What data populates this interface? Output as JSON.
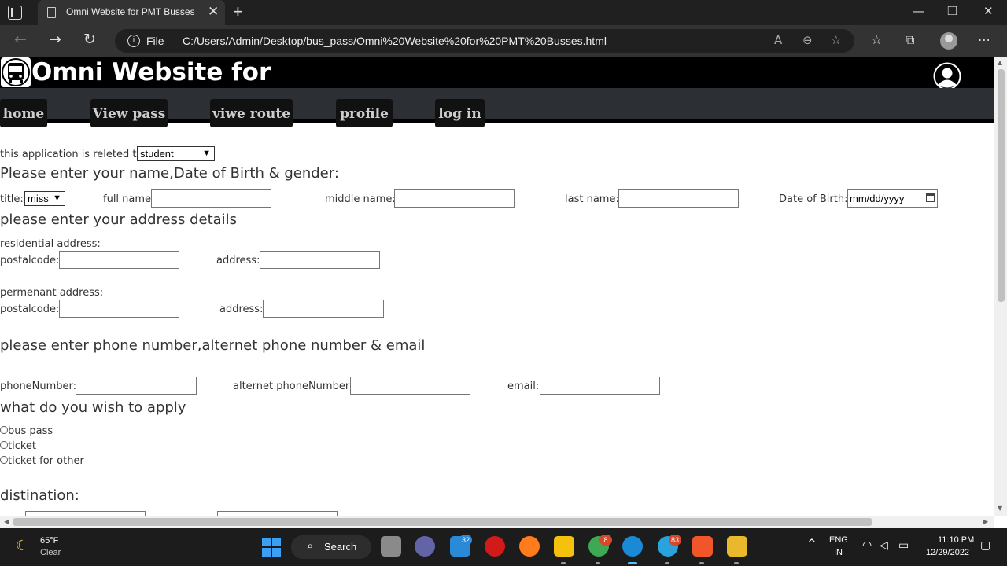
{
  "browser": {
    "tab_title": "Omni Website for PMT Busses",
    "tab_close": "✕",
    "new_tab": "+",
    "file_label": "File",
    "url": "C:/Users/Admin/Desktop/bus_pass/Omni%20Website%20for%20PMT%20Busses.html"
  },
  "site": {
    "title": "Omni Website for",
    "nav": [
      "home",
      "View pass",
      "viwe route",
      "profile",
      "log in"
    ]
  },
  "form": {
    "related_label": "this application is releted to",
    "related_value": "student",
    "name_header": "Please enter your name,Date of Birth & gender:",
    "title_label": "title:",
    "title_value": "miss",
    "fullname_label": "full name:",
    "middlename_label": "middle name:",
    "lastname_label": "last name:",
    "dob_label": "Date of Birth:",
    "dob_placeholder": "mm/dd/yyyy",
    "address_header": "please enter your address details",
    "residential_label": "residential address:",
    "permanent_label": "permenant address:",
    "postalcode_label": "postalcode:",
    "address_label": "address:",
    "phone_header": "please enter phone number,alternet phone number & email",
    "phone_label": "phoneNumber:",
    "alt_phone_label": "alternet phoneNumber:",
    "email_label": "email:",
    "apply_header": "what do you wish to apply",
    "options": [
      "bus pass",
      "ticket",
      "ticket for other"
    ],
    "destination_header": "distination:"
  },
  "taskbar": {
    "temp": "65°F",
    "condition": "Clear",
    "search_label": "Search",
    "badges": {
      "teams_mail": "32",
      "chrome": "8",
      "telegram": "83"
    },
    "lang_1": "ENG",
    "lang_2": "IN",
    "time": "11:10 PM",
    "date": "12/29/2022"
  },
  "colors": {
    "site_header": "#000000",
    "navbar": "#2c2f33",
    "nav_button": "#111111",
    "taskbar": "#1c1c1c"
  }
}
